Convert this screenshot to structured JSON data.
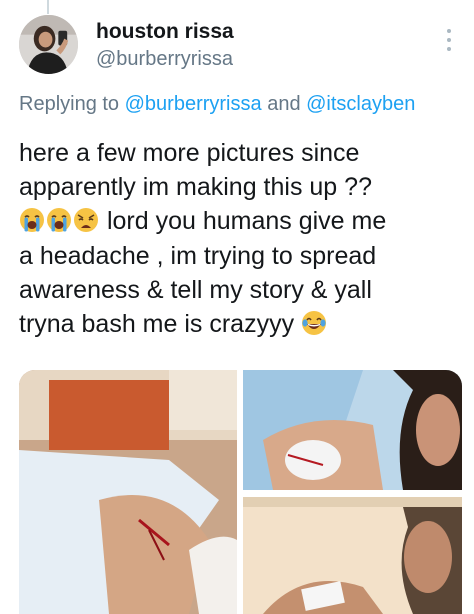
{
  "author": {
    "display_name": "houston rissa",
    "handle": "@burberryrissa",
    "avatar_icon": "profile-photo"
  },
  "reply": {
    "prefix": "Replying to ",
    "mention_1": "@burberryrissa",
    "conjunction": " and ",
    "mention_2": "@itsclayben"
  },
  "tweet": {
    "line_1": "here a few more pictures since",
    "line_2": "apparently im making this up ??",
    "line_3_text": " lord you humans give me",
    "line_4": "a headache , im trying to spread",
    "line_5": "awareness & tell my story & yall",
    "line_6_text": "tryna bash me is crazyyy ",
    "emojis_line_3": [
      "loudly-crying-face",
      "loudly-crying-face",
      "weary-face"
    ],
    "emoji_line_6": "face-with-tears-of-joy"
  },
  "more_icon": "more-vertical",
  "media": {
    "count": 3,
    "tiles": [
      "photo-wound-arm",
      "photo-shoulder-bandage",
      "photo-arm-dressing"
    ]
  },
  "colors": {
    "text": "#14171a",
    "secondary": "#657786",
    "link": "#1da1f2",
    "emoji_yellow": "#f6c344",
    "tear_blue": "#4fa3e0"
  }
}
